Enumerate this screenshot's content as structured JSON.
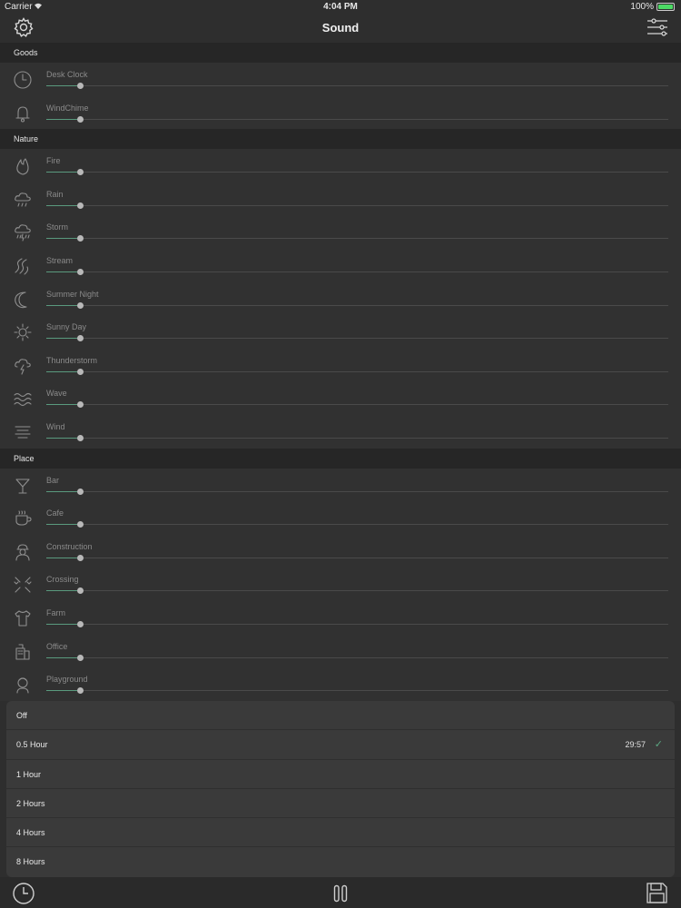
{
  "status_bar": {
    "carrier": "Carrier",
    "time": "4:04 PM",
    "battery": "100%"
  },
  "nav": {
    "title": "Sound",
    "left_icon": "gear-icon",
    "right_icon": "mixer-sliders-icon"
  },
  "sections": [
    {
      "title": "Goods",
      "items": [
        {
          "label": "Desk Clock",
          "icon": "clock",
          "level": 0.05
        },
        {
          "label": "WindChime",
          "icon": "bell",
          "level": 0.05
        }
      ]
    },
    {
      "title": "Nature",
      "items": [
        {
          "label": "Fire",
          "icon": "fire",
          "level": 0.05
        },
        {
          "label": "Rain",
          "icon": "rain",
          "level": 0.05
        },
        {
          "label": "Storm",
          "icon": "storm",
          "level": 0.05
        },
        {
          "label": "Stream",
          "icon": "stream",
          "level": 0.05
        },
        {
          "label": "Summer Night",
          "icon": "moon",
          "level": 0.05
        },
        {
          "label": "Sunny Day",
          "icon": "sun",
          "level": 0.05
        },
        {
          "label": "Thunderstorm",
          "icon": "thunder",
          "level": 0.05
        },
        {
          "label": "Wave",
          "icon": "wave",
          "level": 0.05
        },
        {
          "label": "Wind",
          "icon": "wind",
          "level": 0.05
        }
      ]
    },
    {
      "title": "Place",
      "items": [
        {
          "label": "Bar",
          "icon": "cocktail",
          "level": 0.05
        },
        {
          "label": "Cafe",
          "icon": "cup",
          "level": 0.05
        },
        {
          "label": "Construction",
          "icon": "worker",
          "level": 0.05
        },
        {
          "label": "Crossing",
          "icon": "crossing",
          "level": 0.05
        },
        {
          "label": "Farm",
          "icon": "shirt",
          "level": 0.05
        },
        {
          "label": "Office",
          "icon": "office",
          "level": 0.05
        },
        {
          "label": "Playground",
          "icon": "kid",
          "level": 0.05
        }
      ]
    }
  ],
  "timer_menu": {
    "options": [
      {
        "label": "Off"
      },
      {
        "label": "0.5 Hour",
        "countdown": "29:57",
        "selected": true
      },
      {
        "label": "1 Hour"
      },
      {
        "label": "2 Hours"
      },
      {
        "label": "4 Hours"
      },
      {
        "label": "8 Hours"
      }
    ]
  },
  "toolbar": {
    "timer_icon": "clock-icon",
    "play_icon": "pause-icon",
    "save_icon": "save-icon"
  },
  "colors": {
    "accent": "#5ba882",
    "background": "#2e2e2e"
  }
}
